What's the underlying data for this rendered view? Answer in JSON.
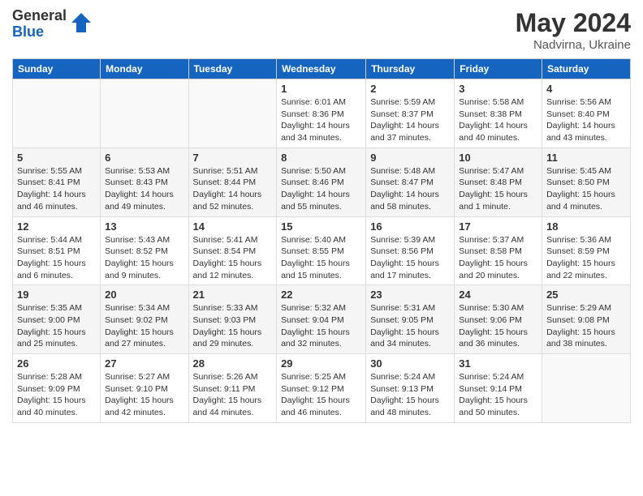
{
  "logo": {
    "general": "General",
    "blue": "Blue"
  },
  "title": {
    "month": "May 2024",
    "location": "Nadvirna, Ukraine"
  },
  "weekdays": [
    "Sunday",
    "Monday",
    "Tuesday",
    "Wednesday",
    "Thursday",
    "Friday",
    "Saturday"
  ],
  "weeks": [
    [
      {
        "day": "",
        "info": ""
      },
      {
        "day": "",
        "info": ""
      },
      {
        "day": "",
        "info": ""
      },
      {
        "day": "1",
        "info": "Sunrise: 6:01 AM\nSunset: 8:36 PM\nDaylight: 14 hours\nand 34 minutes."
      },
      {
        "day": "2",
        "info": "Sunrise: 5:59 AM\nSunset: 8:37 PM\nDaylight: 14 hours\nand 37 minutes."
      },
      {
        "day": "3",
        "info": "Sunrise: 5:58 AM\nSunset: 8:38 PM\nDaylight: 14 hours\nand 40 minutes."
      },
      {
        "day": "4",
        "info": "Sunrise: 5:56 AM\nSunset: 8:40 PM\nDaylight: 14 hours\nand 43 minutes."
      }
    ],
    [
      {
        "day": "5",
        "info": "Sunrise: 5:55 AM\nSunset: 8:41 PM\nDaylight: 14 hours\nand 46 minutes."
      },
      {
        "day": "6",
        "info": "Sunrise: 5:53 AM\nSunset: 8:43 PM\nDaylight: 14 hours\nand 49 minutes."
      },
      {
        "day": "7",
        "info": "Sunrise: 5:51 AM\nSunset: 8:44 PM\nDaylight: 14 hours\nand 52 minutes."
      },
      {
        "day": "8",
        "info": "Sunrise: 5:50 AM\nSunset: 8:46 PM\nDaylight: 14 hours\nand 55 minutes."
      },
      {
        "day": "9",
        "info": "Sunrise: 5:48 AM\nSunset: 8:47 PM\nDaylight: 14 hours\nand 58 minutes."
      },
      {
        "day": "10",
        "info": "Sunrise: 5:47 AM\nSunset: 8:48 PM\nDaylight: 15 hours\nand 1 minute."
      },
      {
        "day": "11",
        "info": "Sunrise: 5:45 AM\nSunset: 8:50 PM\nDaylight: 15 hours\nand 4 minutes."
      }
    ],
    [
      {
        "day": "12",
        "info": "Sunrise: 5:44 AM\nSunset: 8:51 PM\nDaylight: 15 hours\nand 6 minutes."
      },
      {
        "day": "13",
        "info": "Sunrise: 5:43 AM\nSunset: 8:52 PM\nDaylight: 15 hours\nand 9 minutes."
      },
      {
        "day": "14",
        "info": "Sunrise: 5:41 AM\nSunset: 8:54 PM\nDaylight: 15 hours\nand 12 minutes."
      },
      {
        "day": "15",
        "info": "Sunrise: 5:40 AM\nSunset: 8:55 PM\nDaylight: 15 hours\nand 15 minutes."
      },
      {
        "day": "16",
        "info": "Sunrise: 5:39 AM\nSunset: 8:56 PM\nDaylight: 15 hours\nand 17 minutes."
      },
      {
        "day": "17",
        "info": "Sunrise: 5:37 AM\nSunset: 8:58 PM\nDaylight: 15 hours\nand 20 minutes."
      },
      {
        "day": "18",
        "info": "Sunrise: 5:36 AM\nSunset: 8:59 PM\nDaylight: 15 hours\nand 22 minutes."
      }
    ],
    [
      {
        "day": "19",
        "info": "Sunrise: 5:35 AM\nSunset: 9:00 PM\nDaylight: 15 hours\nand 25 minutes."
      },
      {
        "day": "20",
        "info": "Sunrise: 5:34 AM\nSunset: 9:02 PM\nDaylight: 15 hours\nand 27 minutes."
      },
      {
        "day": "21",
        "info": "Sunrise: 5:33 AM\nSunset: 9:03 PM\nDaylight: 15 hours\nand 29 minutes."
      },
      {
        "day": "22",
        "info": "Sunrise: 5:32 AM\nSunset: 9:04 PM\nDaylight: 15 hours\nand 32 minutes."
      },
      {
        "day": "23",
        "info": "Sunrise: 5:31 AM\nSunset: 9:05 PM\nDaylight: 15 hours\nand 34 minutes."
      },
      {
        "day": "24",
        "info": "Sunrise: 5:30 AM\nSunset: 9:06 PM\nDaylight: 15 hours\nand 36 minutes."
      },
      {
        "day": "25",
        "info": "Sunrise: 5:29 AM\nSunset: 9:08 PM\nDaylight: 15 hours\nand 38 minutes."
      }
    ],
    [
      {
        "day": "26",
        "info": "Sunrise: 5:28 AM\nSunset: 9:09 PM\nDaylight: 15 hours\nand 40 minutes."
      },
      {
        "day": "27",
        "info": "Sunrise: 5:27 AM\nSunset: 9:10 PM\nDaylight: 15 hours\nand 42 minutes."
      },
      {
        "day": "28",
        "info": "Sunrise: 5:26 AM\nSunset: 9:11 PM\nDaylight: 15 hours\nand 44 minutes."
      },
      {
        "day": "29",
        "info": "Sunrise: 5:25 AM\nSunset: 9:12 PM\nDaylight: 15 hours\nand 46 minutes."
      },
      {
        "day": "30",
        "info": "Sunrise: 5:24 AM\nSunset: 9:13 PM\nDaylight: 15 hours\nand 48 minutes."
      },
      {
        "day": "31",
        "info": "Sunrise: 5:24 AM\nSunset: 9:14 PM\nDaylight: 15 hours\nand 50 minutes."
      },
      {
        "day": "",
        "info": ""
      }
    ]
  ]
}
